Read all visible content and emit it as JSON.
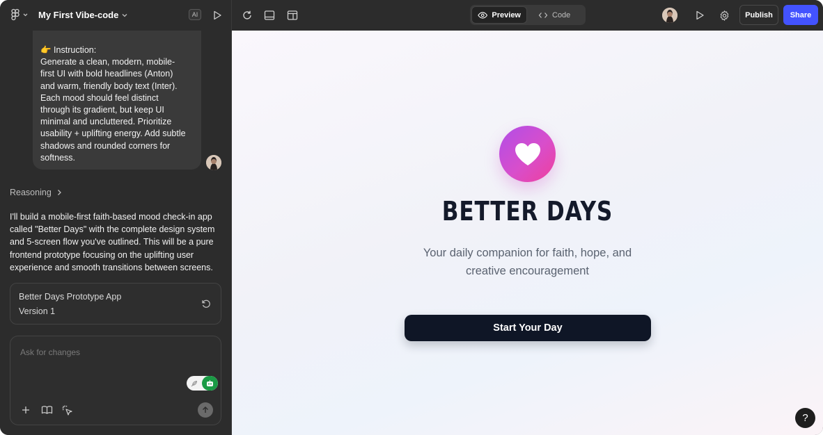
{
  "header": {
    "project_title": "My First Vibe-code",
    "ai_badge": "AI",
    "view_tabs": [
      {
        "label": "Preview",
        "icon": "eye-icon",
        "active": true
      },
      {
        "label": "Code",
        "icon": "code-icon",
        "active": false
      }
    ],
    "publish_label": "Publish",
    "share_label": "Share",
    "accent_color": "#4353ff"
  },
  "chat": {
    "user_message": {
      "emoji": "👉",
      "lines": [
        " Instruction:",
        " Generate a clean, modern, mobile-",
        "first UI with bold headlines (Anton)",
        "and warm, friendly body text (Inter).",
        "Each mood should feel distinct",
        "through its gradient, but keep UI",
        "minimal and uncluttered. Prioritize",
        "usability + uplifting energy. Add subtle",
        "shadows and rounded corners for",
        "softness."
      ]
    },
    "reasoning_label": "Reasoning",
    "assistant_lines": [
      "I'll build a mobile-first faith-based mood check-in app",
      "called \"Better Days\" with the complete design system",
      "and 5-screen flow you've outlined. This will be a pure",
      "frontend prototype focusing on the uplifting user",
      "experience and smooth transitions between screens."
    ],
    "version_card": {
      "title": "Better Days Prototype App",
      "version": "Version 1"
    },
    "composer": {
      "placeholder": "Ask for changes",
      "value": ""
    }
  },
  "preview": {
    "app_title": "BETTER DAYS",
    "tagline_lines": [
      "Your daily companion for faith, hope, and",
      "creative encouragement"
    ],
    "cta_label": "Start Your Day",
    "help_label": "?",
    "icon": "heart-icon"
  }
}
